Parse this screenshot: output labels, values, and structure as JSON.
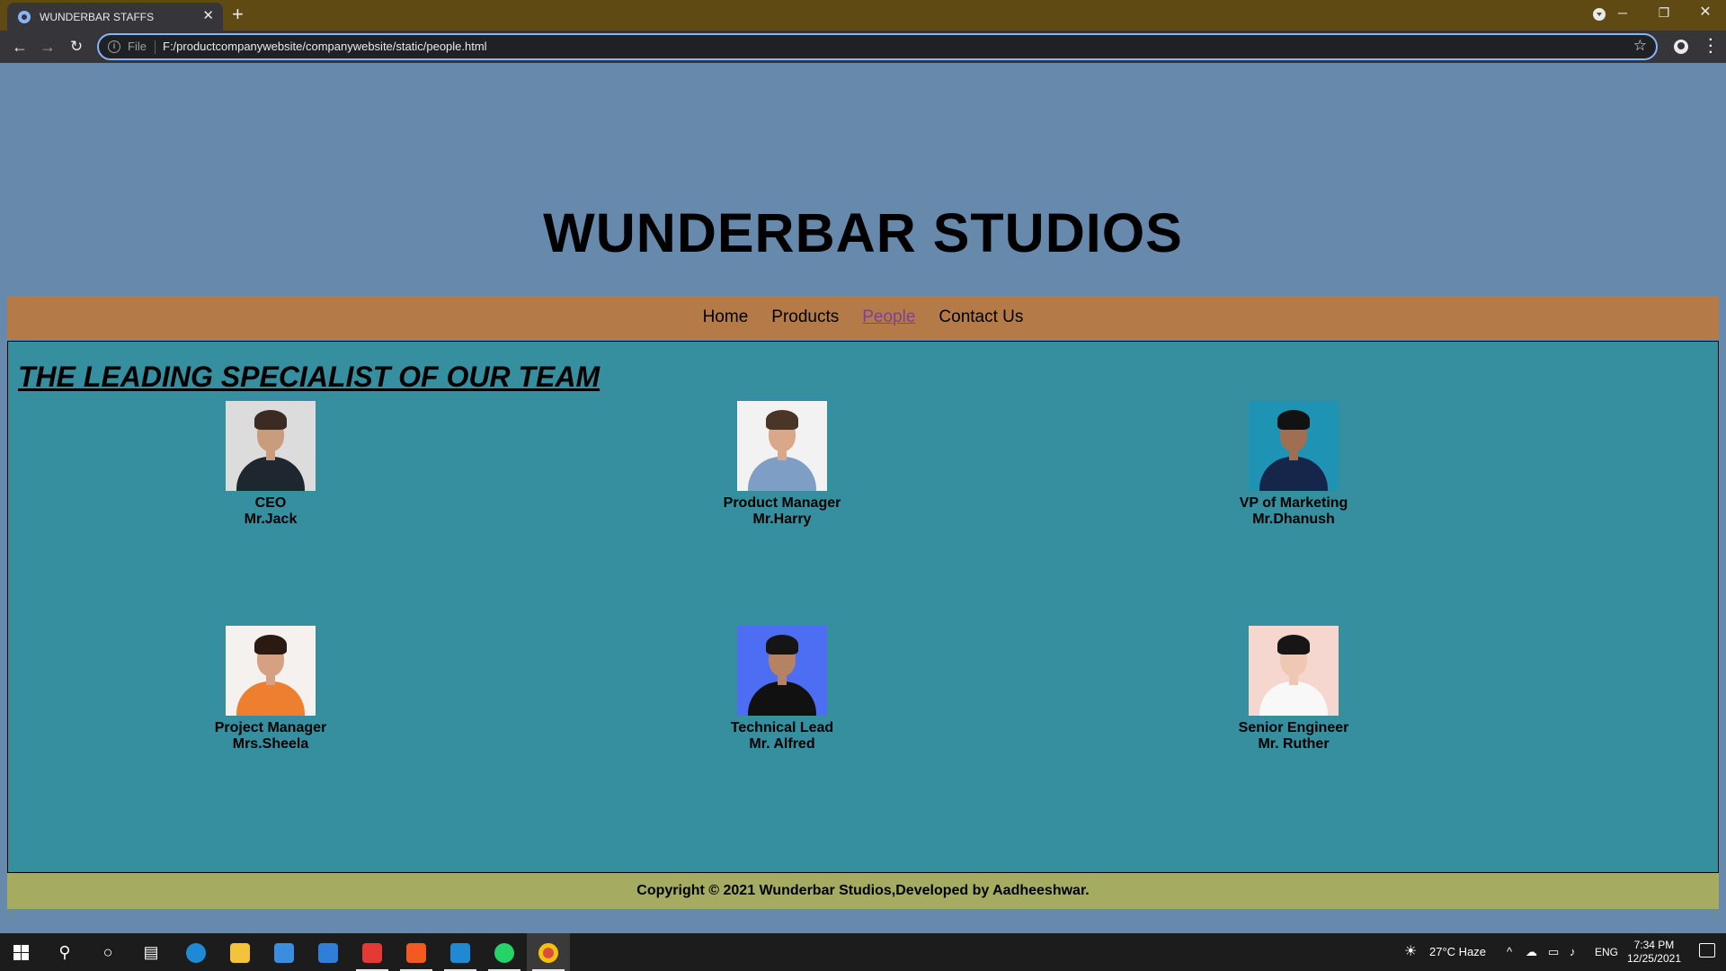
{
  "browser": {
    "tab_title": "WUNDERBAR STAFFS",
    "tab_close": "✕",
    "new_tab": "+",
    "url_scheme": "File",
    "url": "F:/productcompanywebsite/companywebsite/static/people.html"
  },
  "site": {
    "title": "WUNDERBAR STUDIOS",
    "nav": [
      {
        "label": "Home",
        "active": false
      },
      {
        "label": "Products",
        "active": false
      },
      {
        "label": "People",
        "active": true
      },
      {
        "label": "Contact Us",
        "active": false
      }
    ],
    "team_heading": "THE LEADING SPECIALIST OF OUR TEAM",
    "members": [
      {
        "role": "CEO",
        "name": "Mr.Jack",
        "photo_bg": "#dcdcdc",
        "skin": "#c99c7e",
        "hair": "#3b2b22",
        "outfit": "#1e2630"
      },
      {
        "role": "Product Manager",
        "name": "Mr.Harry",
        "photo_bg": "#f2f2f2",
        "skin": "#d9a88a",
        "hair": "#4a3526",
        "outfit": "#7e9ec6"
      },
      {
        "role": "VP of Marketing",
        "name": "Mr.Dhanush",
        "photo_bg": "#1f93b3",
        "skin": "#a06f52",
        "hair": "#121212",
        "outfit": "#16254a"
      },
      {
        "role": "Project Manager",
        "name": "Mrs.Sheela",
        "photo_bg": "#f4f1ef",
        "skin": "#d6a183",
        "hair": "#2b1a12",
        "outfit": "#ee7f2e"
      },
      {
        "role": "Technical Lead",
        "name": "Mr. Alfred",
        "photo_bg": "#4d6df2",
        "skin": "#b58264",
        "hair": "#151515",
        "outfit": "#111111"
      },
      {
        "role": "Senior Engineer",
        "name": "Mr. Ruther",
        "photo_bg": "#f5d7d0",
        "skin": "#efc8b4",
        "hair": "#161616",
        "outfit": "#f8f8f8"
      }
    ],
    "footer": "Copyright © 2021 Wunderbar Studios,Developed by Aadheeshwar."
  },
  "taskbar": {
    "weather": "27°C  Haze",
    "language": "ENG",
    "time": "7:34 PM",
    "date": "12/25/2021"
  }
}
